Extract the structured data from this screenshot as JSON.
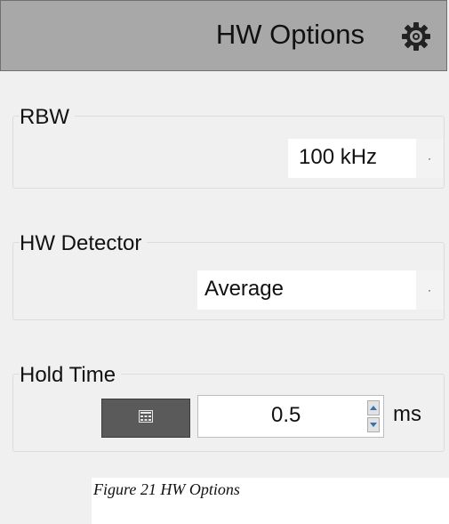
{
  "header": {
    "title": "HW Options",
    "settings_icon": "gear-icon"
  },
  "rbw": {
    "label": "RBW",
    "value": "100 kHz",
    "arrow": "·"
  },
  "detector": {
    "label": "HW Detector",
    "value": "Average",
    "arrow": "·"
  },
  "hold_time": {
    "label": "Hold Time",
    "value": "0.5",
    "unit": "ms",
    "calc_icon": "calculator-icon"
  },
  "caption": {
    "text": "Figure 21 HW Options"
  },
  "colors": {
    "header_bg": "#a8a8a8",
    "panel_bg": "#f0f0f0",
    "button_dark": "#5a5a5a"
  }
}
